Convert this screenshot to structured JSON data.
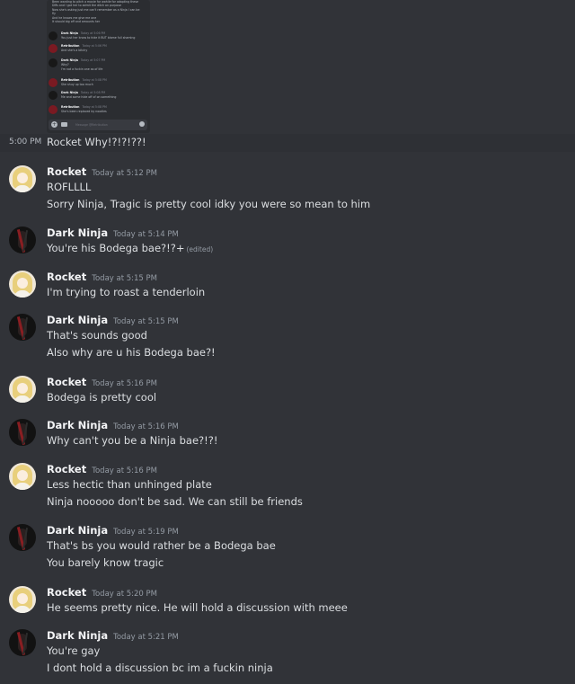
{
  "embed": {
    "lines": [
      "Been wanting to pitch a movie for awhile for adapting these",
      "DMs and I got her to admit the ditch on purpose",
      "Now she's asking just me can't remember as a Ninja I can be",
      "fly",
      "And he knows me give me one",
      "It should big off and amounts her"
    ],
    "messages": [
      {
        "user": "Dark Ninja",
        "time": "Today at 5:06 PM",
        "text": "You just her know to hide it BUT blame full shaming",
        "avatar": "ninja"
      },
      {
        "user": "Retribution",
        "time": "Today at 5:06 PM",
        "text": "And she's a bitchy",
        "avatar": "retri"
      },
      {
        "user": "Dark Ninja",
        "time": "Today at 5:07 PM",
        "text": "Why?",
        "text2": "I'm not a fuckin one as of life",
        "avatar": "ninja"
      },
      {
        "user": "Retribution",
        "time": "Today at 5:08 PM",
        "text": "She shuy up too much",
        "avatar": "retri"
      },
      {
        "user": "Dark Ninja",
        "time": "Today at 5:08 PM",
        "text": "Me and some hide off of on something",
        "avatar": "ninja"
      },
      {
        "user": "Retribution",
        "time": "Today at 5:08 PM",
        "text": "She's been replaced by noodles",
        "avatar": "retri"
      }
    ],
    "input_placeholder": "Message @Retribution"
  },
  "hover": {
    "time": "5:00 PM",
    "text": "Rocket Why!?!?!??!"
  },
  "messages": [
    {
      "user": "Rocket",
      "avatar": "rocket",
      "time": "Today at 5:12 PM",
      "lines": [
        "ROFLLLL",
        "Sorry Ninja, Tragic is pretty cool idky you were so mean to him"
      ]
    },
    {
      "user": "Dark Ninja",
      "avatar": "ninja",
      "time": "Today at 5:14 PM",
      "lines": [
        "You're his Bodega bae?!?+"
      ],
      "edited": "(edited)"
    },
    {
      "user": "Rocket",
      "avatar": "rocket",
      "time": "Today at 5:15 PM",
      "lines": [
        "I'm trying to roast a tenderloin"
      ]
    },
    {
      "user": "Dark Ninja",
      "avatar": "ninja",
      "time": "Today at 5:15 PM",
      "lines": [
        "That's sounds good",
        "Also why are u his Bodega bae?!"
      ]
    },
    {
      "user": "Rocket",
      "avatar": "rocket",
      "time": "Today at 5:16 PM",
      "lines": [
        "Bodega is pretty cool"
      ]
    },
    {
      "user": "Dark Ninja",
      "avatar": "ninja",
      "time": "Today at 5:16 PM",
      "lines": [
        "Why can't you be a Ninja bae?!?!"
      ]
    },
    {
      "user": "Rocket",
      "avatar": "rocket",
      "time": "Today at 5:16 PM",
      "lines": [
        "Less hectic than unhinged plate",
        "Ninja nooooo don't be sad. We can still be friends"
      ]
    },
    {
      "user": "Dark Ninja",
      "avatar": "ninja",
      "time": "Today at 5:19 PM",
      "lines": [
        "That's bs you would rather be a Bodega bae",
        "You barely know tragic"
      ]
    },
    {
      "user": "Rocket",
      "avatar": "rocket",
      "time": "Today at 5:20 PM",
      "lines": [
        "He seems pretty nice. He will hold a discussion with meee"
      ]
    },
    {
      "user": "Dark Ninja",
      "avatar": "ninja",
      "time": "Today at 5:21 PM",
      "lines": [
        "You're gay",
        "I dont hold a discussion bc im a fuckin ninja"
      ]
    }
  ]
}
